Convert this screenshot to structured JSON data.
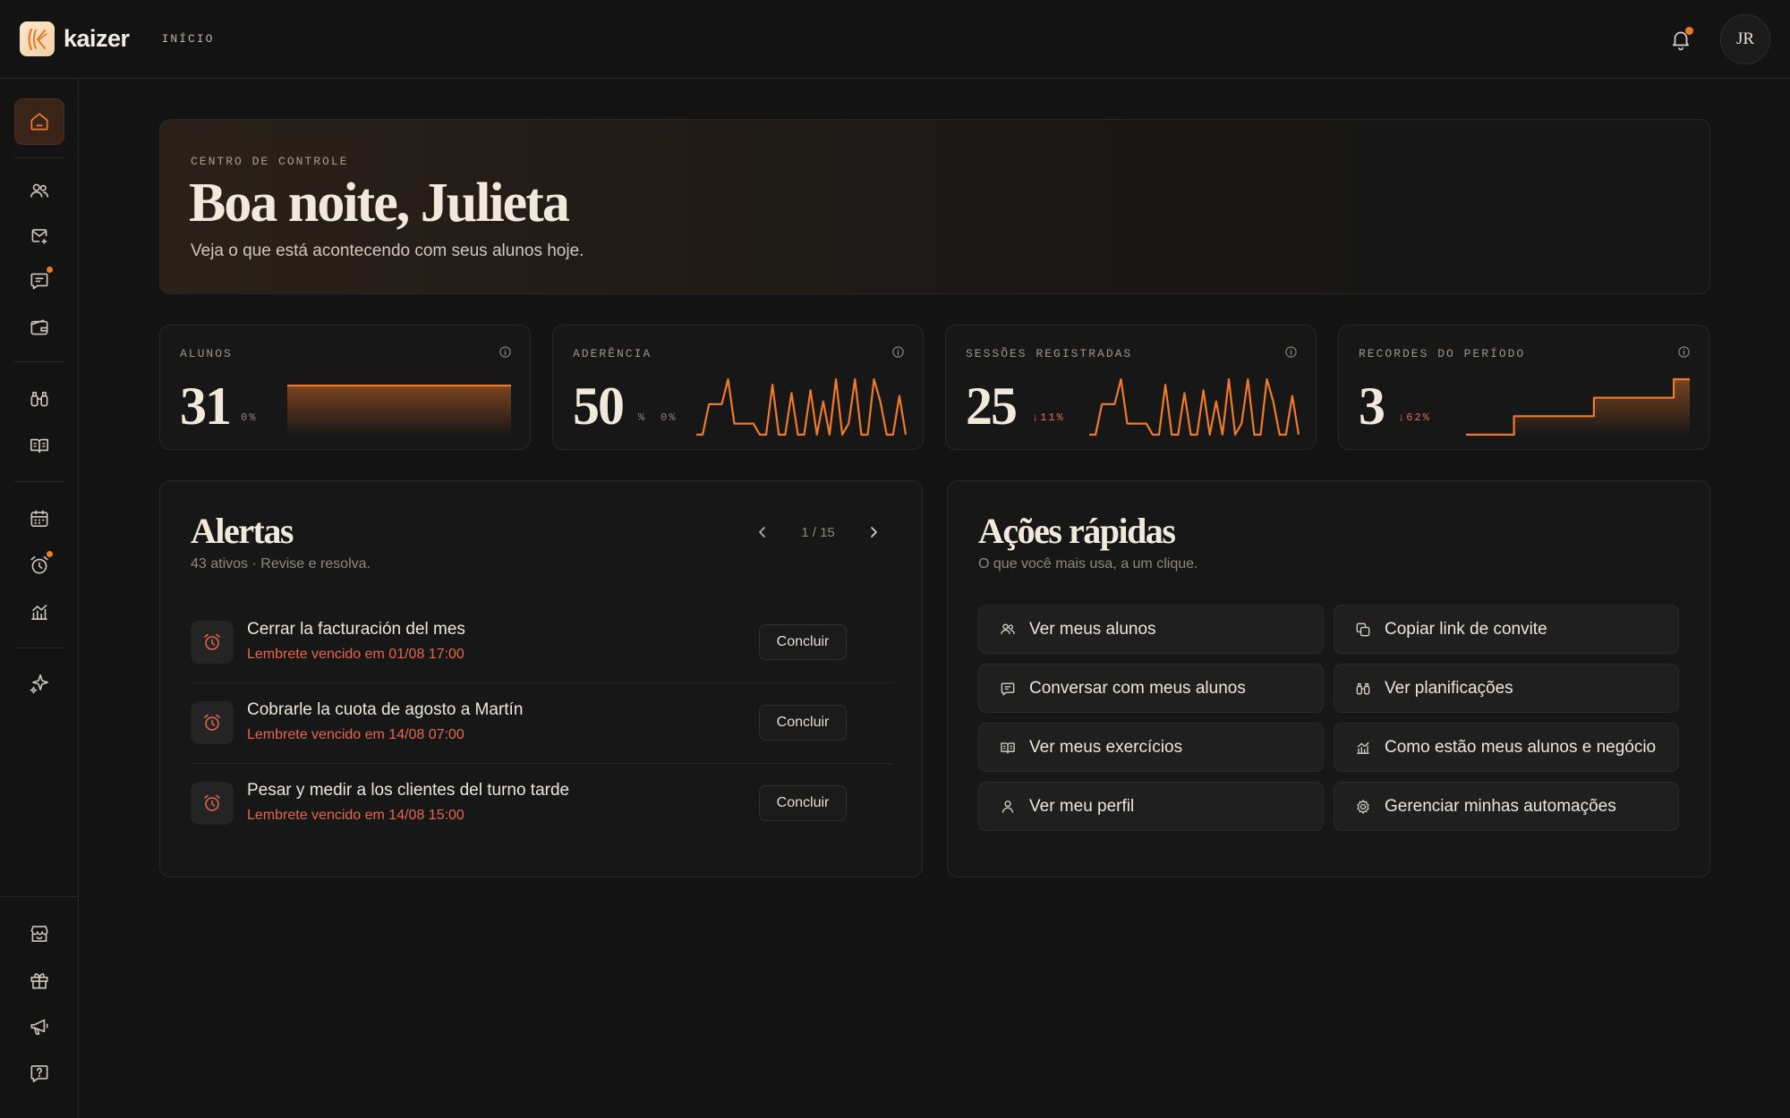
{
  "app": {
    "brand": "kaizer",
    "breadcrumb": "INÍCIO",
    "user_initials": "JR"
  },
  "hero": {
    "eyebrow": "CENTRO DE CONTROLE",
    "title": "Boa noite, Julieta",
    "subtitle": "Veja o que está acontecendo com seus alunos hoje."
  },
  "metrics": [
    {
      "label": "ALUNOS",
      "value": "31",
      "unit": "",
      "change": "0%",
      "trend": "flat",
      "icon": "info-icon"
    },
    {
      "label": "ADERÊNCIA",
      "value": "50",
      "unit": "%",
      "change": "0%",
      "trend": "flat",
      "icon": "info-icon"
    },
    {
      "label": "SESSÕES REGISTRADAS",
      "value": "25",
      "unit": "",
      "change": "↓11%",
      "trend": "down",
      "icon": "info-icon"
    },
    {
      "label": "RECORDES DO PERÍODO",
      "value": "3",
      "unit": "",
      "change": "↓62%",
      "trend": "down",
      "icon": "info-icon"
    }
  ],
  "chart_data": [
    {
      "type": "area",
      "name": "alunos",
      "values": [
        31,
        31,
        31,
        31,
        31,
        31,
        31,
        31,
        31,
        31,
        31,
        31,
        31,
        31,
        31,
        31,
        31,
        31,
        31,
        31
      ],
      "ylim": [
        0,
        35
      ]
    },
    {
      "type": "line",
      "name": "aderencia",
      "values": [
        0,
        0,
        0.55,
        0.55,
        0.55,
        1,
        0.2,
        0.2,
        0.2,
        0.2,
        0,
        0,
        0.9,
        0,
        0,
        0.75,
        0,
        0,
        0.8,
        0,
        0.6,
        0,
        1,
        0,
        0.2,
        1,
        0,
        0,
        1,
        0.6,
        0,
        0,
        0.7,
        0
      ],
      "ylim": [
        0,
        1
      ]
    },
    {
      "type": "line",
      "name": "sessoes",
      "values": [
        0,
        0,
        0.55,
        0.55,
        0.55,
        1,
        0.2,
        0.2,
        0.2,
        0.2,
        0,
        0,
        0.9,
        0,
        0,
        0.75,
        0,
        0,
        0.8,
        0,
        0.6,
        0,
        1,
        0,
        0.2,
        1,
        0,
        0,
        1,
        0.6,
        0,
        0,
        0.7,
        0
      ],
      "ylim": [
        0,
        1
      ]
    },
    {
      "type": "area",
      "name": "recordes",
      "step": true,
      "values": [
        0,
        0,
        0,
        1,
        1,
        1,
        1,
        1,
        2,
        2,
        2,
        2,
        2,
        3,
        3
      ],
      "ylim": [
        0,
        3
      ]
    }
  ],
  "alerts": {
    "title": "Alertas",
    "subtitle": "43 ativos · Revise e resolva.",
    "pager": "1 / 15",
    "items": [
      {
        "title": "Cerrar la facturación del mes",
        "meta": "Lembrete vencido em 01/08 17:00",
        "action": "Concluir"
      },
      {
        "title": "Cobrarle la cuota de agosto a Martín",
        "meta": "Lembrete vencido em 14/08 07:00",
        "action": "Concluir"
      },
      {
        "title": "Pesar y medir a los clientes del turno tarde",
        "meta": "Lembrete vencido em 14/08 15:00",
        "action": "Concluir"
      }
    ]
  },
  "quick_actions": {
    "title": "Ações rápidas",
    "subtitle": "O que você mais usa, a um clique.",
    "items": [
      {
        "label": "Ver meus alunos",
        "icon": "users-icon"
      },
      {
        "label": "Copiar link de convite",
        "icon": "copy-icon"
      },
      {
        "label": "Conversar com meus alunos",
        "icon": "chat-icon"
      },
      {
        "label": "Ver planificações",
        "icon": "binoculars-icon"
      },
      {
        "label": "Ver meus exercícios",
        "icon": "book-icon"
      },
      {
        "label": "Como estão meus alunos e negócio",
        "icon": "analytics-icon"
      },
      {
        "label": "Ver meu perfil",
        "icon": "person-icon"
      },
      {
        "label": "Gerenciar minhas automações",
        "icon": "automation-icon"
      }
    ]
  },
  "colors": {
    "accent": "#f07a2c",
    "alert": "#e5674f",
    "background": "#131313",
    "card": "#171717"
  }
}
